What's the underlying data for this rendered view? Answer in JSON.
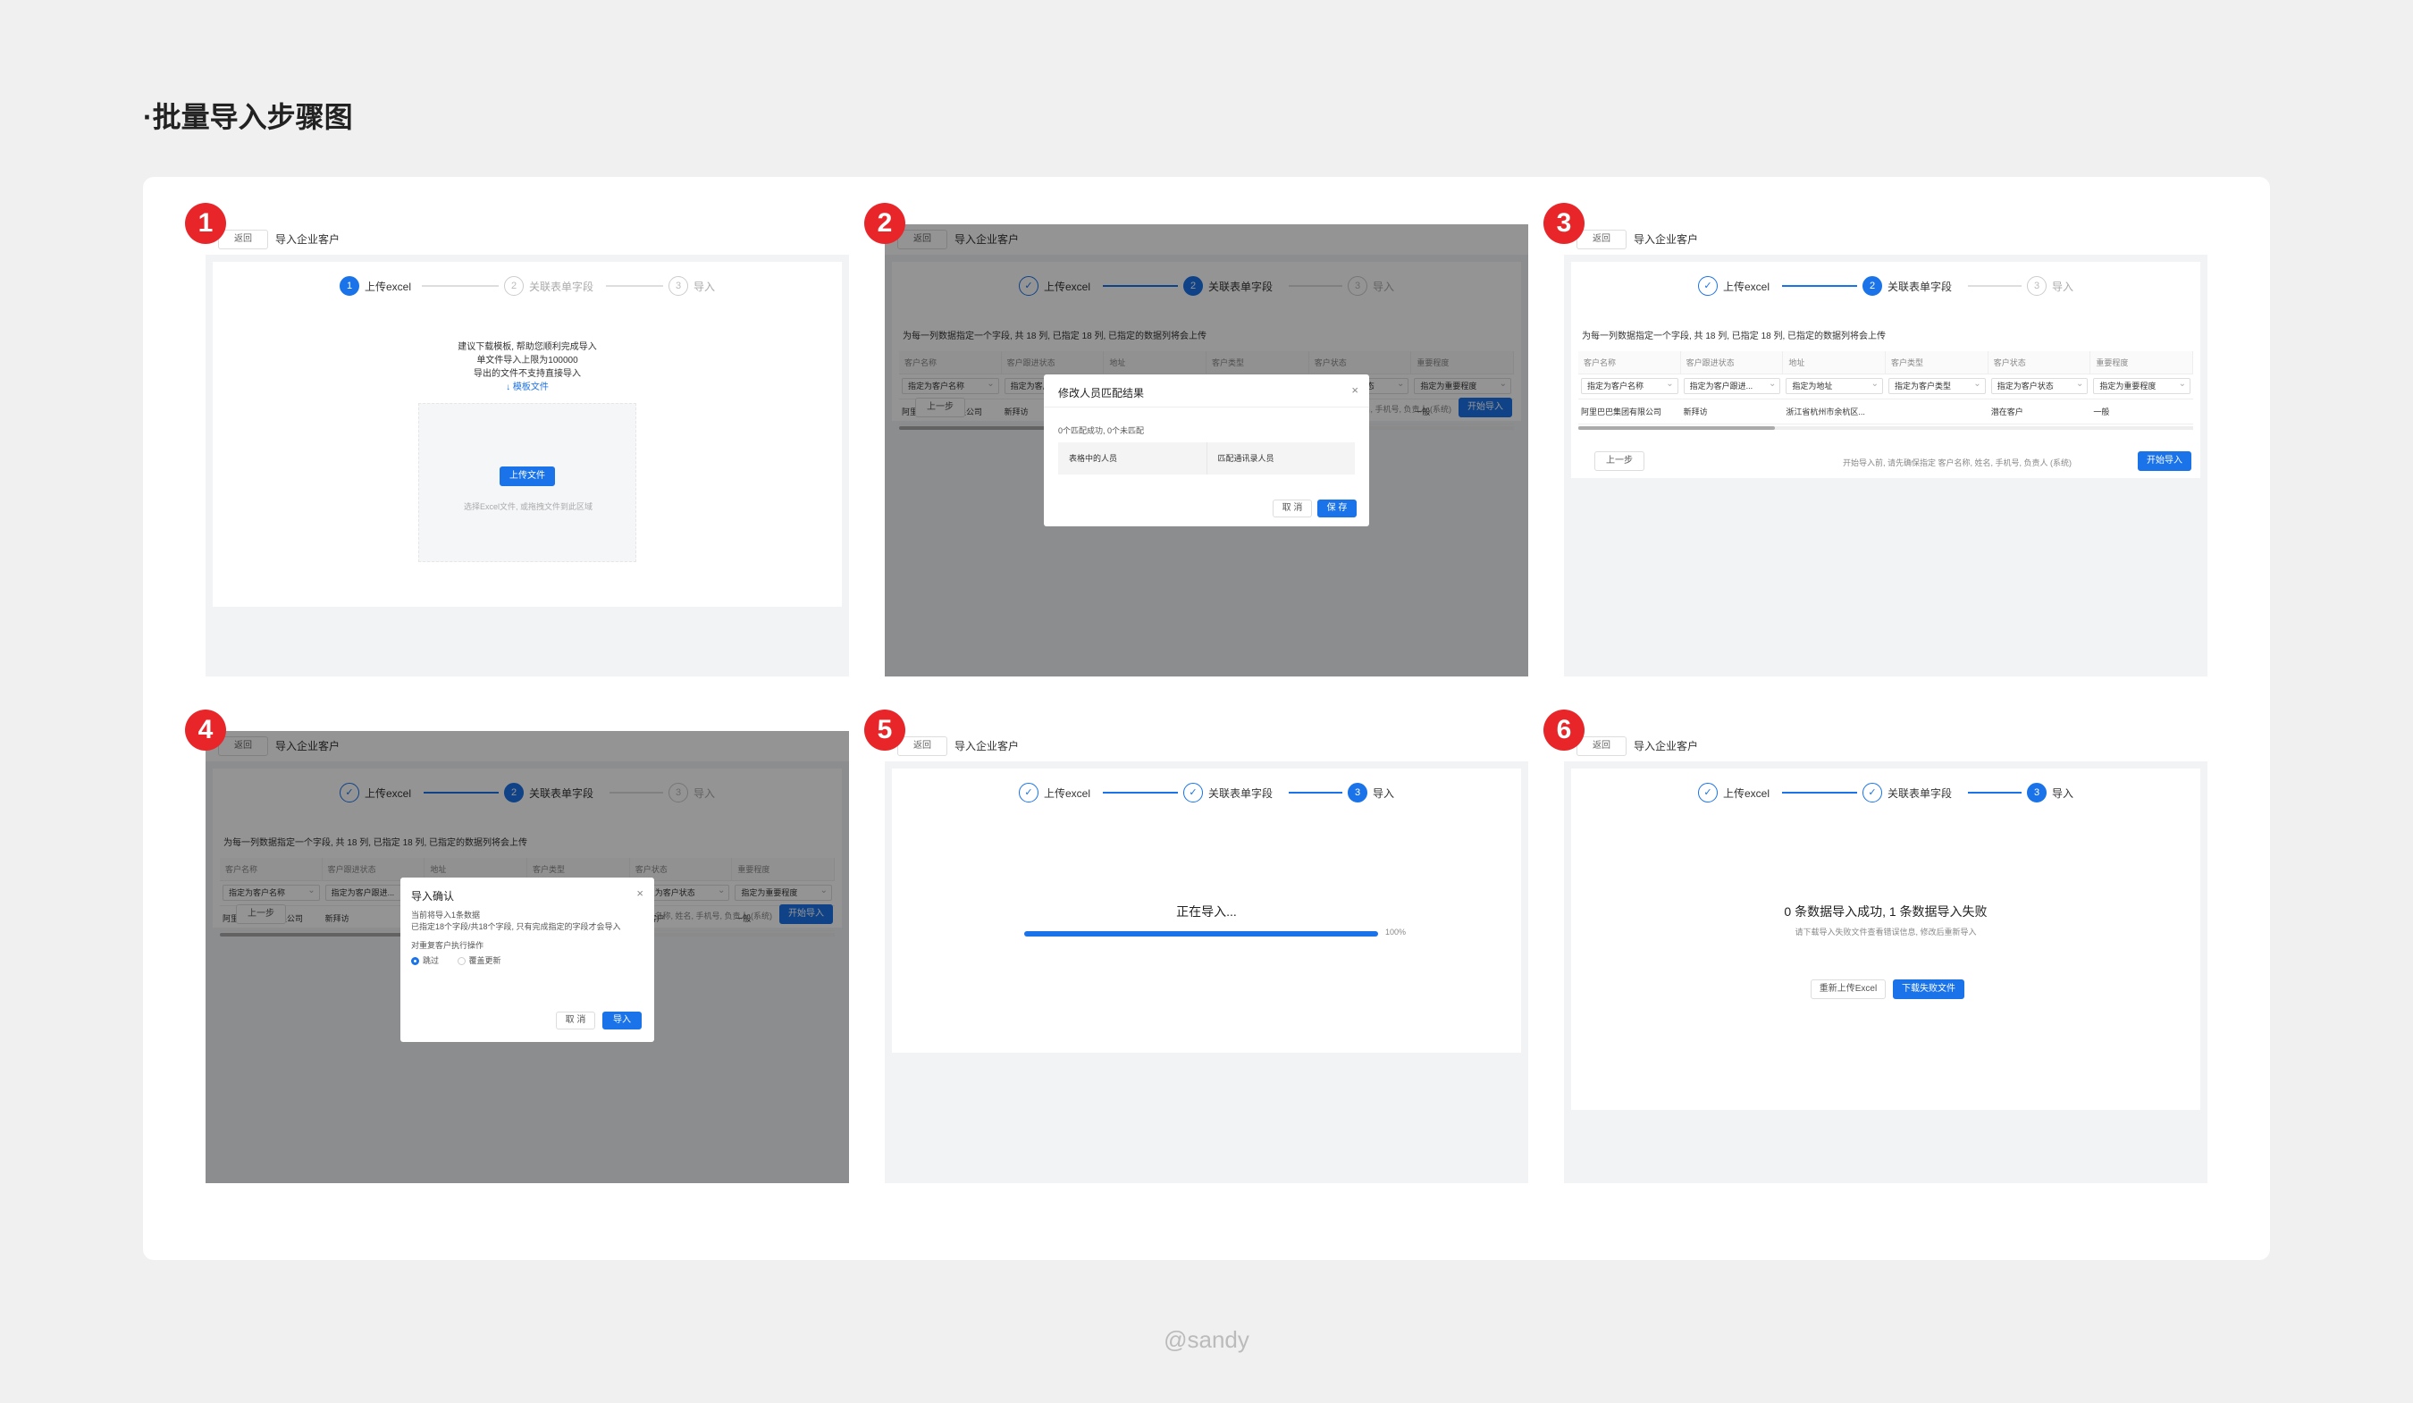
{
  "page_title": "·批量导入步骤图",
  "credit": "@sandy",
  "common": {
    "back_label": "返回",
    "bar_title": "导入企业客户",
    "steps": [
      "上传excel",
      "关联表单字段",
      "导入"
    ],
    "step_numbers": [
      "1",
      "2",
      "3"
    ],
    "prev_label": "上一步",
    "start_label": "开始导入",
    "hint": "为每一列数据指定一个字段, 共 18 列, 已指定 18 列, 已指定的数据列将会上传",
    "headers": [
      "客户名称",
      "客户跟进状态",
      "地址",
      "客户类型",
      "客户状态",
      "重要程度"
    ],
    "selects": [
      "指定为客户名称",
      "指定为客户跟进...",
      "指定为地址",
      "指定为客户类型",
      "指定为客户状态",
      "指定为重要程度"
    ],
    "row": [
      "阿里巴巴集团有限公司",
      "新拜访",
      "浙江省杭州市余杭区...",
      "",
      "潜在客户",
      "一般"
    ],
    "foot_note": "开始导入前, 请先确保指定 客户名称, 姓名, 手机号, 负责人 (系统)"
  },
  "panel1": {
    "badge": "1",
    "lines": [
      "建议下载模板, 帮助您顺利完成导入",
      "单文件导入上限为100000",
      "导出的文件不支持直接导入"
    ],
    "template_link": "↓ 模板文件",
    "upload_button": "上传文件",
    "upload_hint": "选择Excel文件, 或拖拽文件到此区域"
  },
  "panel2": {
    "badge": "2",
    "modal_title": "修改人员匹配结果",
    "summary": "0个匹配成功, 0个未匹配",
    "col1": "表格中的人员",
    "col2": "匹配通讯录人员",
    "cancel": "取 消",
    "save": "保 存"
  },
  "panel3": {
    "badge": "3"
  },
  "panel4": {
    "badge": "4",
    "modal_title": "导入确认",
    "line1": "当前将导入1条数据",
    "line2": "已指定18个字段/共18个字段, 只有完成指定的字段才会导入",
    "repeat_label": "对重复客户执行操作",
    "option_skip": "跳过",
    "option_cover": "覆盖更新",
    "cancel": "取 消",
    "import": "导入"
  },
  "panel5": {
    "badge": "5",
    "status": "正在导入...",
    "percent_label": "100%",
    "progress": 1.0
  },
  "panel6": {
    "badge": "6",
    "result": "0 条数据导入成功, 1 条数据导入失败",
    "sub": "请下载导入失败文件查看错误信息, 修改后重新导入",
    "reupload": "重新上传Excel",
    "download": "下载失败文件"
  },
  "colors": {
    "accent": "#1a73e8",
    "badge": "#e8262a"
  }
}
